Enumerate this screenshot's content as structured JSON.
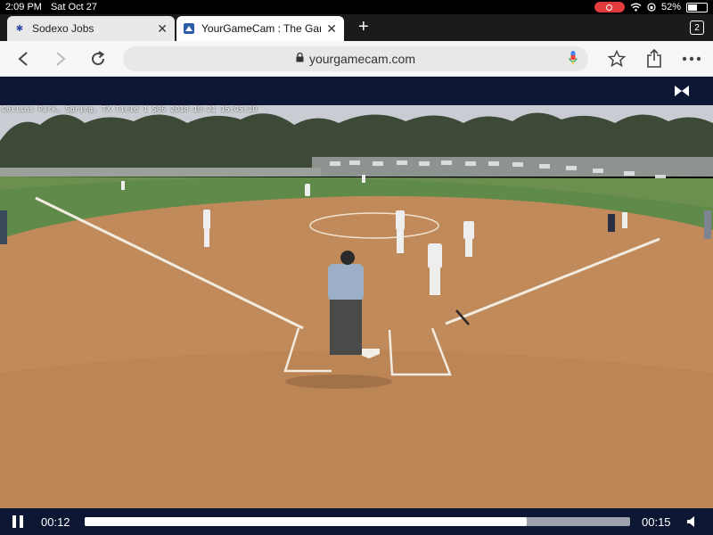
{
  "status_bar": {
    "time": "2:09 PM",
    "date": "Sat Oct 27",
    "battery": "52%",
    "battery_level": 0.52
  },
  "tabs": [
    {
      "title": "Sodexo Jobs",
      "favicon": "sodexo-star-icon",
      "active": false
    },
    {
      "title": "YourGameCam : The Game",
      "favicon": "yourgamecam-icon",
      "active": true
    }
  ],
  "tab_count": "2",
  "address_bar": {
    "url": "yourgamecam.com"
  },
  "video": {
    "overlay_text": "Collins Park, Spring, TX Field 1   S06 2018-10-21 15:05:10",
    "current_time": "00:12",
    "duration": "00:15",
    "progress_fraction": 0.81,
    "buffered_fraction": 1.0
  },
  "colors": {
    "site_header": "#0d1633",
    "dirt": "#c08a5a",
    "grass": "#5f8a4a"
  },
  "icons": [
    "back-arrow-icon",
    "forward-arrow-icon",
    "reload-icon",
    "lock-icon",
    "microphone-icon",
    "bookmark-star-icon",
    "share-icon",
    "more-icon",
    "bowtie-logo-icon",
    "pause-icon",
    "volume-icon"
  ]
}
